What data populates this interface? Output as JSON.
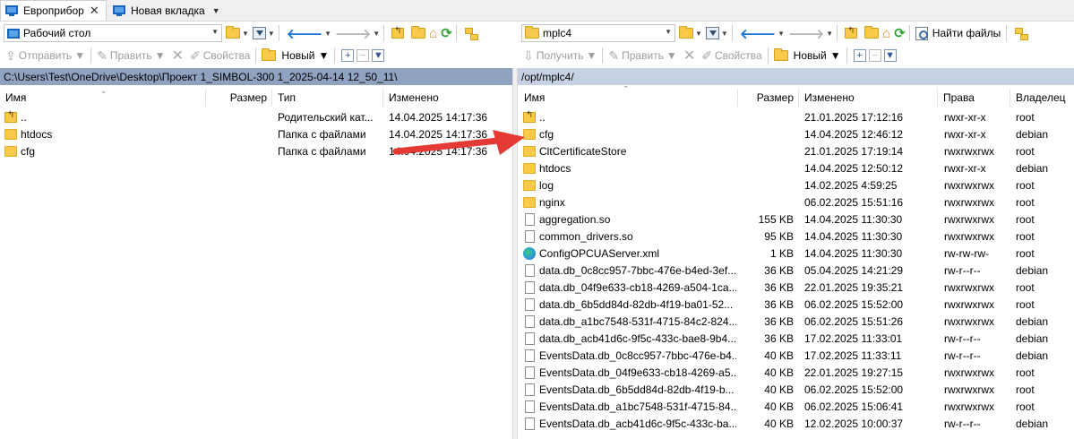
{
  "tabs": [
    {
      "label": "Европрибор",
      "active": true,
      "icon": "monitor-icon"
    },
    {
      "label": "Новая вкладка",
      "active": false,
      "icon": "monitor-icon"
    }
  ],
  "left_toolbar": {
    "drive_label": "Рабочий стол",
    "send_label": "Отправить",
    "edit_label": "Править",
    "props_label": "Свойства",
    "new_label": "Новый"
  },
  "right_toolbar": {
    "drive_label": "mplc4",
    "find_files_label": "Найти файлы",
    "receive_label": "Получить",
    "edit_label": "Править",
    "props_label": "Свойства",
    "new_label": "Новый"
  },
  "left_pane": {
    "path": "C:\\Users\\Test\\OneDrive\\Desktop\\Проект 1_SIMBOL-300 1_2025-04-14 12_50_11\\",
    "columns": {
      "name": "Имя",
      "size": "Размер",
      "type": "Тип",
      "modified": "Изменено"
    },
    "rows": [
      {
        "name": "..",
        "icon": "parent",
        "size": "",
        "type": "Родительский кат...",
        "modified": "14.04.2025 14:17:36"
      },
      {
        "name": "htdocs",
        "icon": "folder",
        "size": "",
        "type": "Папка с файлами",
        "modified": "14.04.2025 14:17:36"
      },
      {
        "name": "cfg",
        "icon": "folder",
        "size": "",
        "type": "Папка с файлами",
        "modified": "14.04.2025 14:17:36"
      }
    ]
  },
  "right_pane": {
    "path": "/opt/mplc4/",
    "columns": {
      "name": "Имя",
      "size": "Размер",
      "modified": "Изменено",
      "rights": "Права",
      "owner": "Владелец"
    },
    "rows": [
      {
        "name": "..",
        "icon": "parent",
        "size": "",
        "modified": "21.01.2025 17:12:16",
        "rights": "rwxr-xr-x",
        "owner": "root"
      },
      {
        "name": "cfg",
        "icon": "folder",
        "size": "",
        "modified": "14.04.2025 12:46:12",
        "rights": "rwxr-xr-x",
        "owner": "debian"
      },
      {
        "name": "CltCertificateStore",
        "icon": "folder",
        "size": "",
        "modified": "21.01.2025 17:19:14",
        "rights": "rwxrwxrwx",
        "owner": "root"
      },
      {
        "name": "htdocs",
        "icon": "folder",
        "size": "",
        "modified": "14.04.2025 12:50:12",
        "rights": "rwxr-xr-x",
        "owner": "debian"
      },
      {
        "name": "log",
        "icon": "folder",
        "size": "",
        "modified": "14.02.2025 4:59:25",
        "rights": "rwxrwxrwx",
        "owner": "root"
      },
      {
        "name": "nginx",
        "icon": "folder",
        "size": "",
        "modified": "06.02.2025 15:51:16",
        "rights": "rwxrwxrwx",
        "owner": "root"
      },
      {
        "name": "aggregation.so",
        "icon": "file",
        "size": "155 KB",
        "modified": "14.04.2025 11:30:30",
        "rights": "rwxrwxrwx",
        "owner": "root"
      },
      {
        "name": "common_drivers.so",
        "icon": "file",
        "size": "95 KB",
        "modified": "14.04.2025 11:30:30",
        "rights": "rwxrwxrwx",
        "owner": "root"
      },
      {
        "name": "ConfigOPCUAServer.xml",
        "icon": "edge",
        "size": "1 KB",
        "modified": "14.04.2025 11:30:30",
        "rights": "rw-rw-rw-",
        "owner": "root"
      },
      {
        "name": "data.db_0c8cc957-7bbc-476e-b4ed-3ef...",
        "icon": "file",
        "size": "36 KB",
        "modified": "05.04.2025 14:21:29",
        "rights": "rw-r--r--",
        "owner": "debian"
      },
      {
        "name": "data.db_04f9e633-cb18-4269-a504-1ca...",
        "icon": "file",
        "size": "36 KB",
        "modified": "22.01.2025 19:35:21",
        "rights": "rwxrwxrwx",
        "owner": "root"
      },
      {
        "name": "data.db_6b5dd84d-82db-4f19-ba01-52...",
        "icon": "file",
        "size": "36 KB",
        "modified": "06.02.2025 15:52:00",
        "rights": "rwxrwxrwx",
        "owner": "root"
      },
      {
        "name": "data.db_a1bc7548-531f-4715-84c2-824...",
        "icon": "file",
        "size": "36 KB",
        "modified": "06.02.2025 15:51:26",
        "rights": "rwxrwxrwx",
        "owner": "debian"
      },
      {
        "name": "data.db_acb41d6c-9f5c-433c-bae8-9b4...",
        "icon": "file",
        "size": "36 KB",
        "modified": "17.02.2025 11:33:01",
        "rights": "rw-r--r--",
        "owner": "debian"
      },
      {
        "name": "EventsData.db_0c8cc957-7bbc-476e-b4...",
        "icon": "file",
        "size": "40 KB",
        "modified": "17.02.2025 11:33:11",
        "rights": "rw-r--r--",
        "owner": "debian"
      },
      {
        "name": "EventsData.db_04f9e633-cb18-4269-a5...",
        "icon": "file",
        "size": "40 KB",
        "modified": "22.01.2025 19:27:15",
        "rights": "rwxrwxrwx",
        "owner": "root"
      },
      {
        "name": "EventsData.db_6b5dd84d-82db-4f19-b...",
        "icon": "file",
        "size": "40 KB",
        "modified": "06.02.2025 15:52:00",
        "rights": "rwxrwxrwx",
        "owner": "root"
      },
      {
        "name": "EventsData.db_a1bc7548-531f-4715-84...",
        "icon": "file",
        "size": "40 KB",
        "modified": "06.02.2025 15:06:41",
        "rights": "rwxrwxrwx",
        "owner": "root"
      },
      {
        "name": "EventsData.db_acb41d6c-9f5c-433c-ba...",
        "icon": "file",
        "size": "40 KB",
        "modified": "12.02.2025 10:00:37",
        "rights": "rw-r--r--",
        "owner": "debian"
      }
    ]
  },
  "annotation": {
    "type": "red-arrow",
    "color": "#e53935"
  },
  "colors": {
    "left_path_bg": "#8fa3c1",
    "right_path_bg": "#c6d2e4",
    "folder": "#f9c94a",
    "accent_blue": "#1a73d9"
  }
}
